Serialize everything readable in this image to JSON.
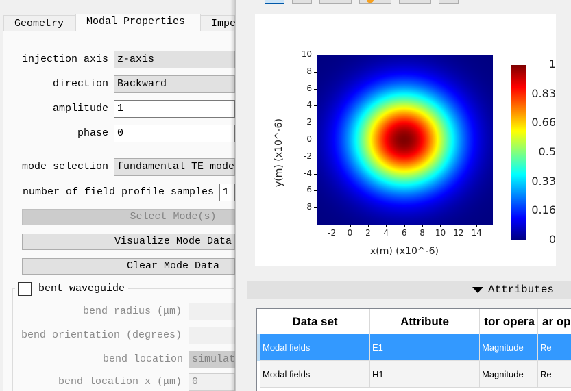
{
  "tabs": [
    {
      "label": "Geometry"
    },
    {
      "label": "Modal Properties"
    },
    {
      "label": "Impe"
    }
  ],
  "modal": {
    "injection_axis": {
      "label": "injection axis",
      "value": "z-axis"
    },
    "direction": {
      "label": "direction",
      "value": "Backward"
    },
    "amplitude": {
      "label": "amplitude",
      "value": "1"
    },
    "phase": {
      "label": "phase",
      "value": "0"
    },
    "mode_selection": {
      "label": "mode selection",
      "value": "fundamental TE mode"
    },
    "samples": {
      "label": "number of field profile samples",
      "value": "1"
    },
    "select_modes": "Select Mode(s)",
    "visualize": "Visualize Mode Data",
    "clear": "Clear Mode Data"
  },
  "bent": {
    "label": "bent waveguide",
    "checked": false,
    "radius_label": "bend radius (μm)",
    "radius_value": "",
    "orientation_label": "bend orientation (degrees)",
    "orientation_value": "",
    "location_label": "bend location",
    "location_value": "simulat",
    "location_x_label": "bend location x (μm)",
    "location_x_value": "0"
  },
  "attributes": {
    "label": "Attributes"
  },
  "table": {
    "headers": [
      "Data set",
      "Attribute",
      "tor opera",
      "ar op"
    ],
    "rows": [
      [
        "Modal fields",
        "E1",
        "Magnitude",
        "Re"
      ],
      [
        "Modal fields",
        "H1",
        "Magnitude",
        "Re"
      ]
    ],
    "selected_row": 0
  },
  "chart_data": {
    "type": "heatmap",
    "title": "",
    "xlabel": "x(m) (x10^-6)",
    "ylabel": "y(m) (x10^-6)",
    "xlim": [
      -3.6,
      15.8
    ],
    "ylim": [
      -10,
      10
    ],
    "xticks": [
      "-2",
      "0",
      "2",
      "4",
      "6",
      "8",
      "10",
      "12",
      "14"
    ],
    "yticks": [
      "10",
      "8",
      "6",
      "4",
      "2",
      "0",
      "-2",
      "-4",
      "-6",
      "-8"
    ],
    "colorbar_ticks": [
      "1",
      "0.83",
      "0.66",
      "0.5",
      "0.33",
      "0.16",
      "0"
    ],
    "colormap": "jet",
    "zlim": [
      0,
      1
    ],
    "field": {
      "shape": "gaussian",
      "center_x": 6,
      "center_y": 0,
      "width": 5.4,
      "peak": 1
    }
  },
  "colors": {
    "selection": "#3399ff",
    "accent": "#0058a8"
  }
}
